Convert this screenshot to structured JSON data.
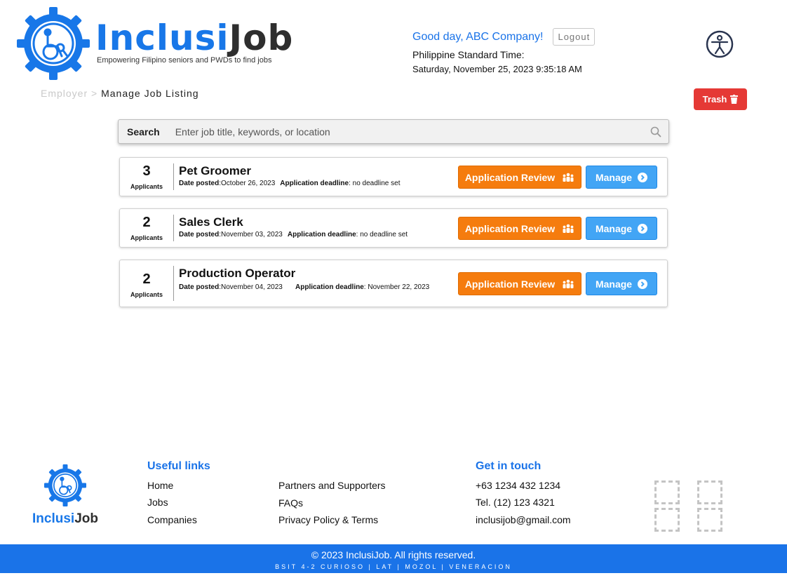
{
  "brand": {
    "name_part1": "Inclusi",
    "name_part2": "Job",
    "tagline": "Empowering Filipino seniors and PWDs to find jobs",
    "primary_color": "#1877e8"
  },
  "header": {
    "greeting": "Good day, ABC Company!",
    "logout_label": "Logout",
    "time_label": "Philippine Standard Time:",
    "datetime": "Saturday, November 25, 2023 9:35:18 AM",
    "accessibility_icon": "accessibility-icon"
  },
  "breadcrumb": {
    "parent": "Employer",
    "separator": ">",
    "current": "Manage Job Listing"
  },
  "trash": {
    "label": "Trash",
    "icon": "trash-icon",
    "color": "#e53935"
  },
  "search": {
    "label": "Search",
    "placeholder": "Enter job title, keywords, or location",
    "value": ""
  },
  "jobs": [
    {
      "count": "3",
      "count_label": "Applicants",
      "title": "Pet Groomer",
      "date_label": "Date posted",
      "date": "October 26, 2023",
      "deadline_label": "Application deadline",
      "deadline": "no deadline set",
      "review_label": "Application Review",
      "manage_label": "Manage"
    },
    {
      "count": "2",
      "count_label": "Applicants",
      "title": "Sales Clerk",
      "date_label": "Date posted",
      "date": "November 03, 2023",
      "deadline_label": "Application deadline",
      "deadline": "no deadline set",
      "review_label": "Application Review",
      "manage_label": "Manage"
    },
    {
      "count": "2",
      "count_label": "Applicants",
      "title": "Production Operator",
      "date_label": "Date posted",
      "date": "November 04, 2023",
      "deadline_label": "Application deadline",
      "deadline": "November 22, 2023",
      "review_label": "Application Review",
      "manage_label": "Manage"
    }
  ],
  "footer": {
    "useful_links_heading": "Useful links",
    "links_col1": [
      "Home",
      "Jobs",
      "Companies"
    ],
    "links_col2": [
      "Partners and Supporters",
      "FAQs",
      "Privacy Policy & Terms"
    ],
    "contact_heading": "Get in touch",
    "phone1": "+63 1234 432 1234",
    "phone2": "Tel. (12) 123 4321",
    "email": "inclusijob@gmail.com",
    "copyright": "© 2023 InclusiJob. All rights reserved.",
    "credits": "BSIT 4-2 CURIOSO | LAT | MOZOL | VENERACION",
    "bar_color": "#1a73e8"
  }
}
